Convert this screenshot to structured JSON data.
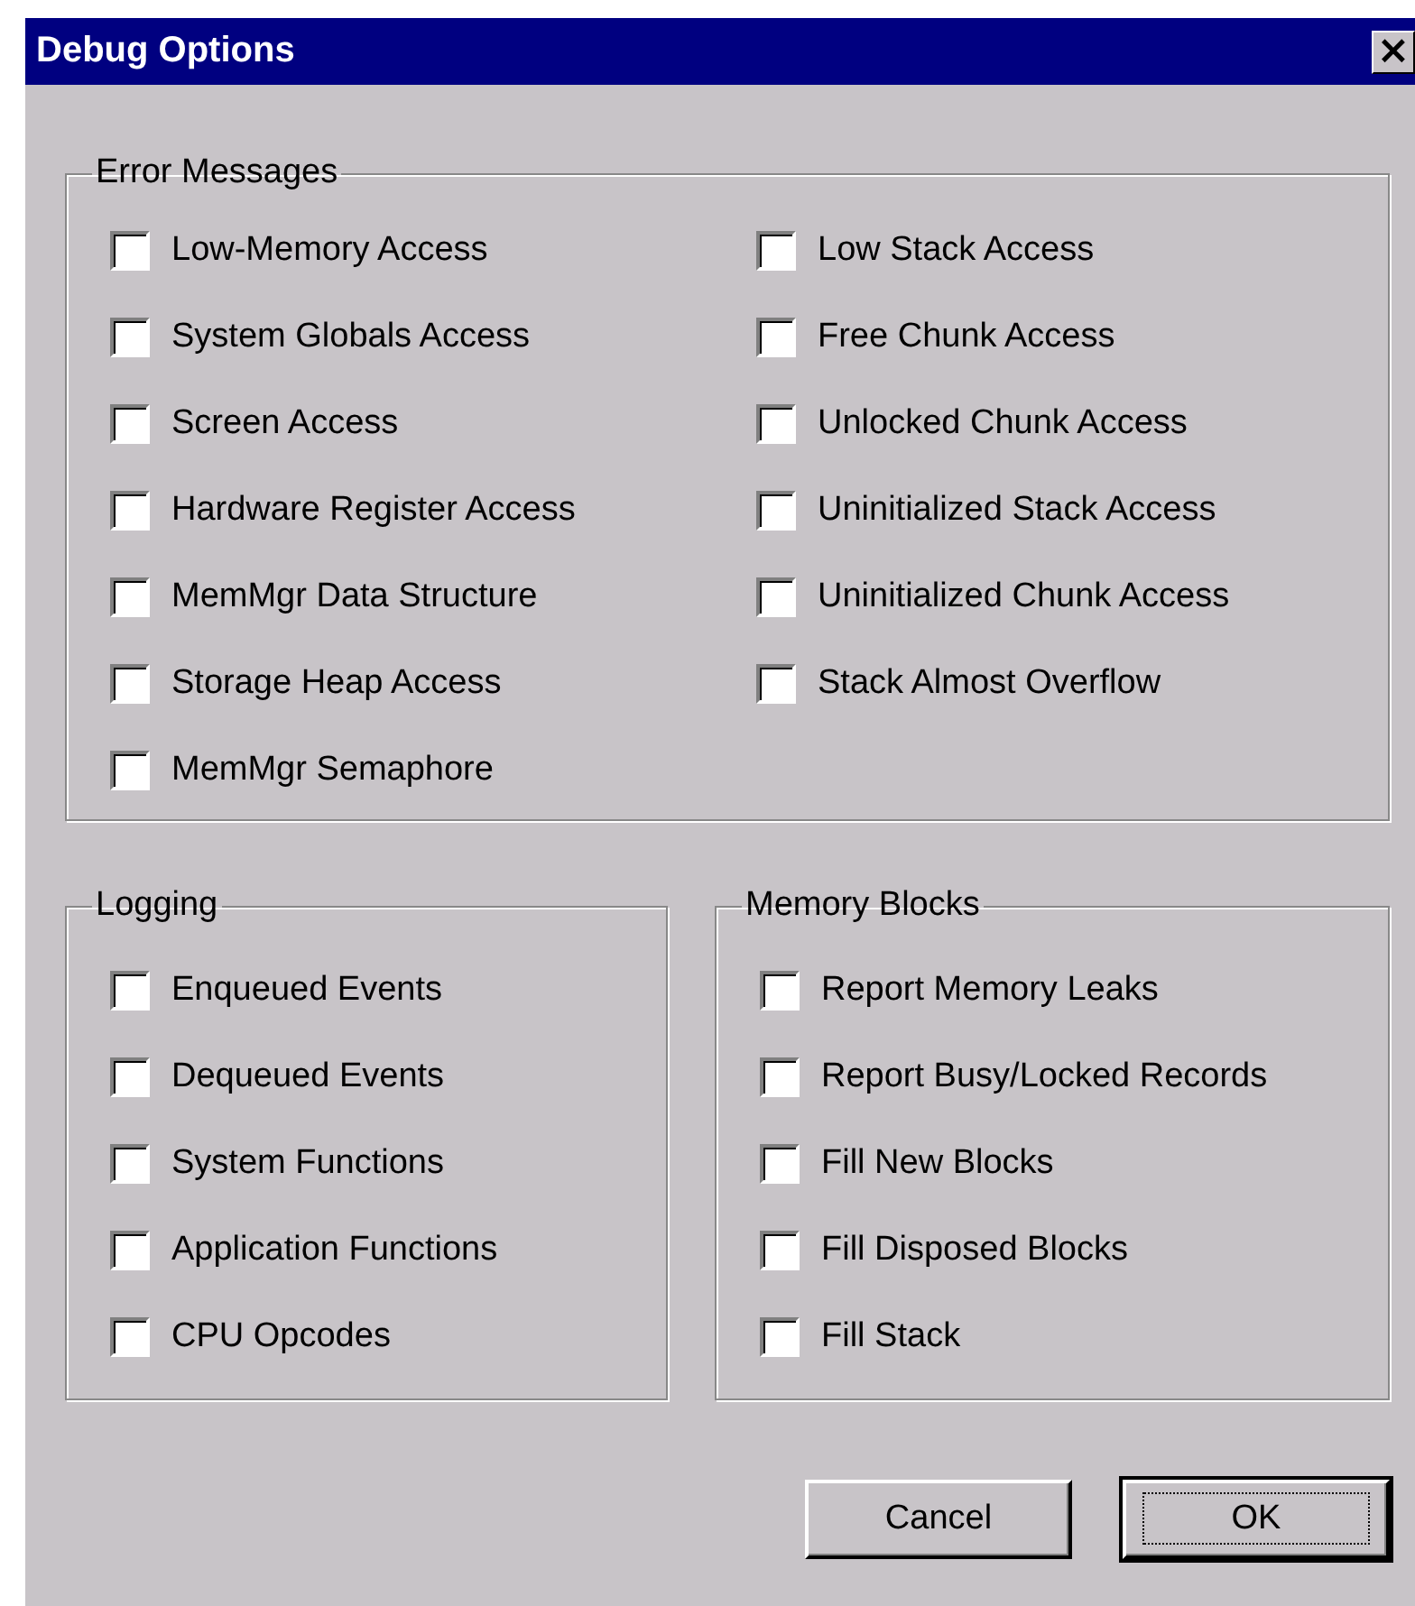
{
  "window": {
    "title": "Debug Options",
    "close": "×"
  },
  "error_messages": {
    "title": "Error Messages",
    "columns": [
      [
        {
          "label": "Low-Memory Access",
          "checked": false
        },
        {
          "label": "System Globals Access",
          "checked": false
        },
        {
          "label": "Screen Access",
          "checked": false
        },
        {
          "label": "Hardware Register Access",
          "checked": false
        },
        {
          "label": "MemMgr Data Structure",
          "checked": false
        },
        {
          "label": "Storage Heap Access",
          "checked": false
        },
        {
          "label": "MemMgr Semaphore",
          "checked": false
        }
      ],
      [
        {
          "label": "Low Stack Access",
          "checked": false
        },
        {
          "label": "Free Chunk Access",
          "checked": false
        },
        {
          "label": "Unlocked Chunk Access",
          "checked": false
        },
        {
          "label": "Uninitialized Stack Access",
          "checked": false
        },
        {
          "label": "Uninitialized Chunk Access",
          "checked": false
        },
        {
          "label": "Stack Almost Overflow",
          "checked": false
        }
      ]
    ]
  },
  "logging": {
    "title": "Logging",
    "items": [
      {
        "label": "Enqueued Events",
        "checked": false
      },
      {
        "label": "Dequeued Events",
        "checked": false
      },
      {
        "label": "System Functions",
        "checked": false
      },
      {
        "label": "Application Functions",
        "checked": false
      },
      {
        "label": "CPU Opcodes",
        "checked": false
      }
    ]
  },
  "memory_blocks": {
    "title": "Memory Blocks",
    "items": [
      {
        "label": "Report Memory Leaks",
        "checked": false
      },
      {
        "label": "Report Busy/Locked Records",
        "checked": false
      },
      {
        "label": "Fill New Blocks",
        "checked": false
      },
      {
        "label": "Fill Disposed Blocks",
        "checked": false
      },
      {
        "label": "Fill Stack",
        "checked": false
      }
    ]
  },
  "buttons": [
    {
      "label": "Cancel",
      "default": false
    },
    {
      "label": "OK",
      "default": true
    }
  ]
}
